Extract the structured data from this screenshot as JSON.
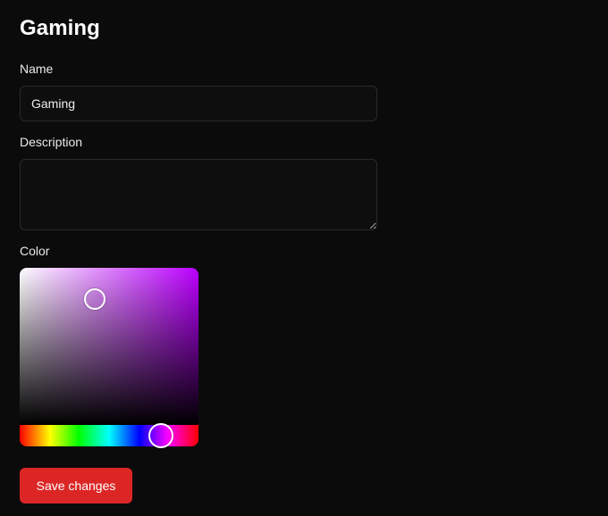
{
  "page": {
    "title": "Gaming"
  },
  "form": {
    "name_label": "Name",
    "name_value": "Gaming",
    "description_label": "Description",
    "description_value": "",
    "color_label": "Color"
  },
  "color_picker": {
    "hue_color": "#bb00ff",
    "saturation": 0.42,
    "brightness": 0.8,
    "hue_fraction": 0.79
  },
  "actions": {
    "save_label": "Save changes",
    "save_color": "#dc2626"
  }
}
